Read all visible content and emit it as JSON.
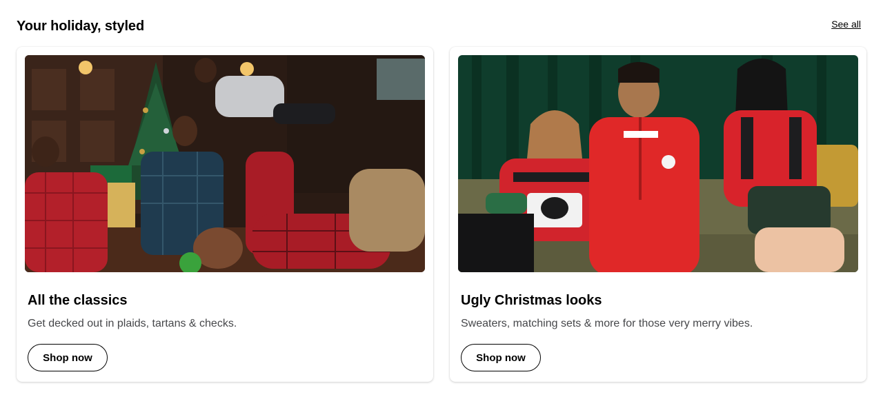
{
  "section": {
    "title": "Your holiday, styled",
    "see_all_label": "See all"
  },
  "cards": [
    {
      "title": "All the classics",
      "description": "Get decked out in plaids, tartans & checks.",
      "button_label": "Shop now",
      "image_alt": "Family in plaid outfits celebrating by a Christmas tree"
    },
    {
      "title": "Ugly Christmas looks",
      "description": "Sweaters, matching sets & more for those very merry vibes.",
      "button_label": "Shop now",
      "image_alt": "Three friends in festive red sweaters on a green sofa"
    }
  ],
  "colors": {
    "text_primary": "#000000",
    "text_secondary": "#46474a",
    "plaid_red": "#b3202a",
    "holiday_green": "#0f3d2c"
  }
}
